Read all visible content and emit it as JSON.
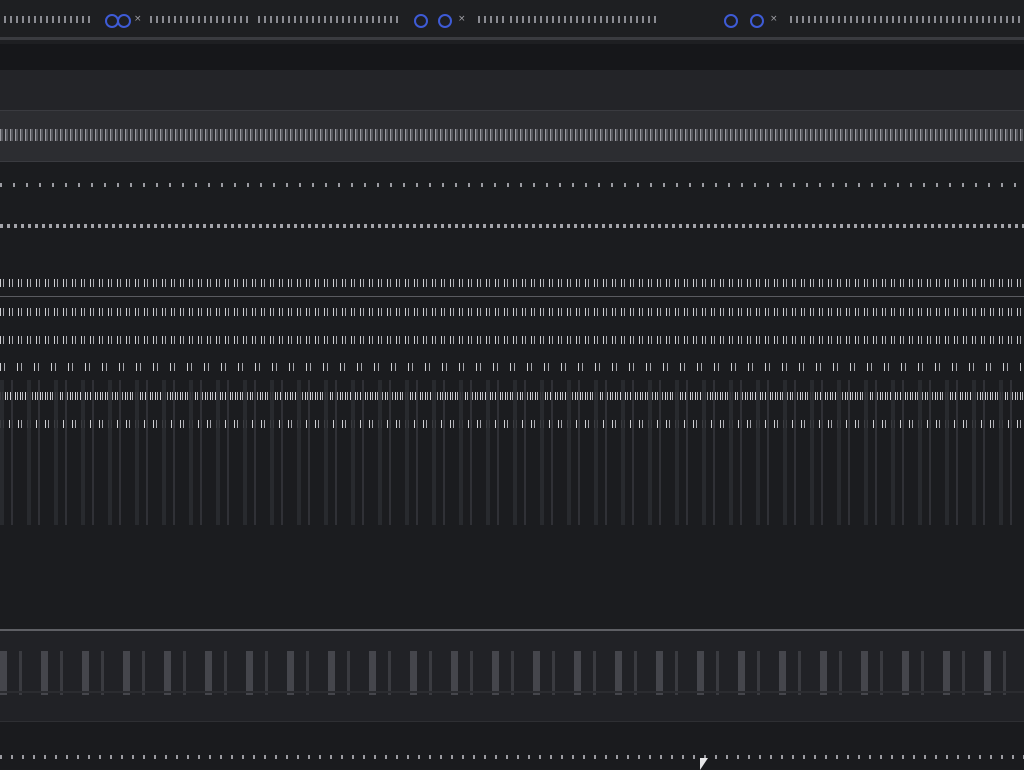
{
  "browser": {
    "tabs": [
      {
        "label": ""
      },
      {
        "label": ""
      },
      {
        "label": ""
      },
      {
        "label": ""
      }
    ],
    "address": ""
  },
  "toolbar": {
    "label": ""
  },
  "banner": {
    "text": ""
  },
  "content": {
    "nav_row": "",
    "meta_row": "",
    "table_header": "",
    "rows": [
      "",
      "",
      "",
      "",
      ""
    ]
  },
  "footer": {
    "text": ""
  },
  "status_bar": {
    "text": ""
  },
  "colors": {
    "background": "#1b1c1f",
    "tab_icon_accent": "#3e5bd6",
    "text": "#c8c8cc",
    "divider": "#5e5f64"
  }
}
